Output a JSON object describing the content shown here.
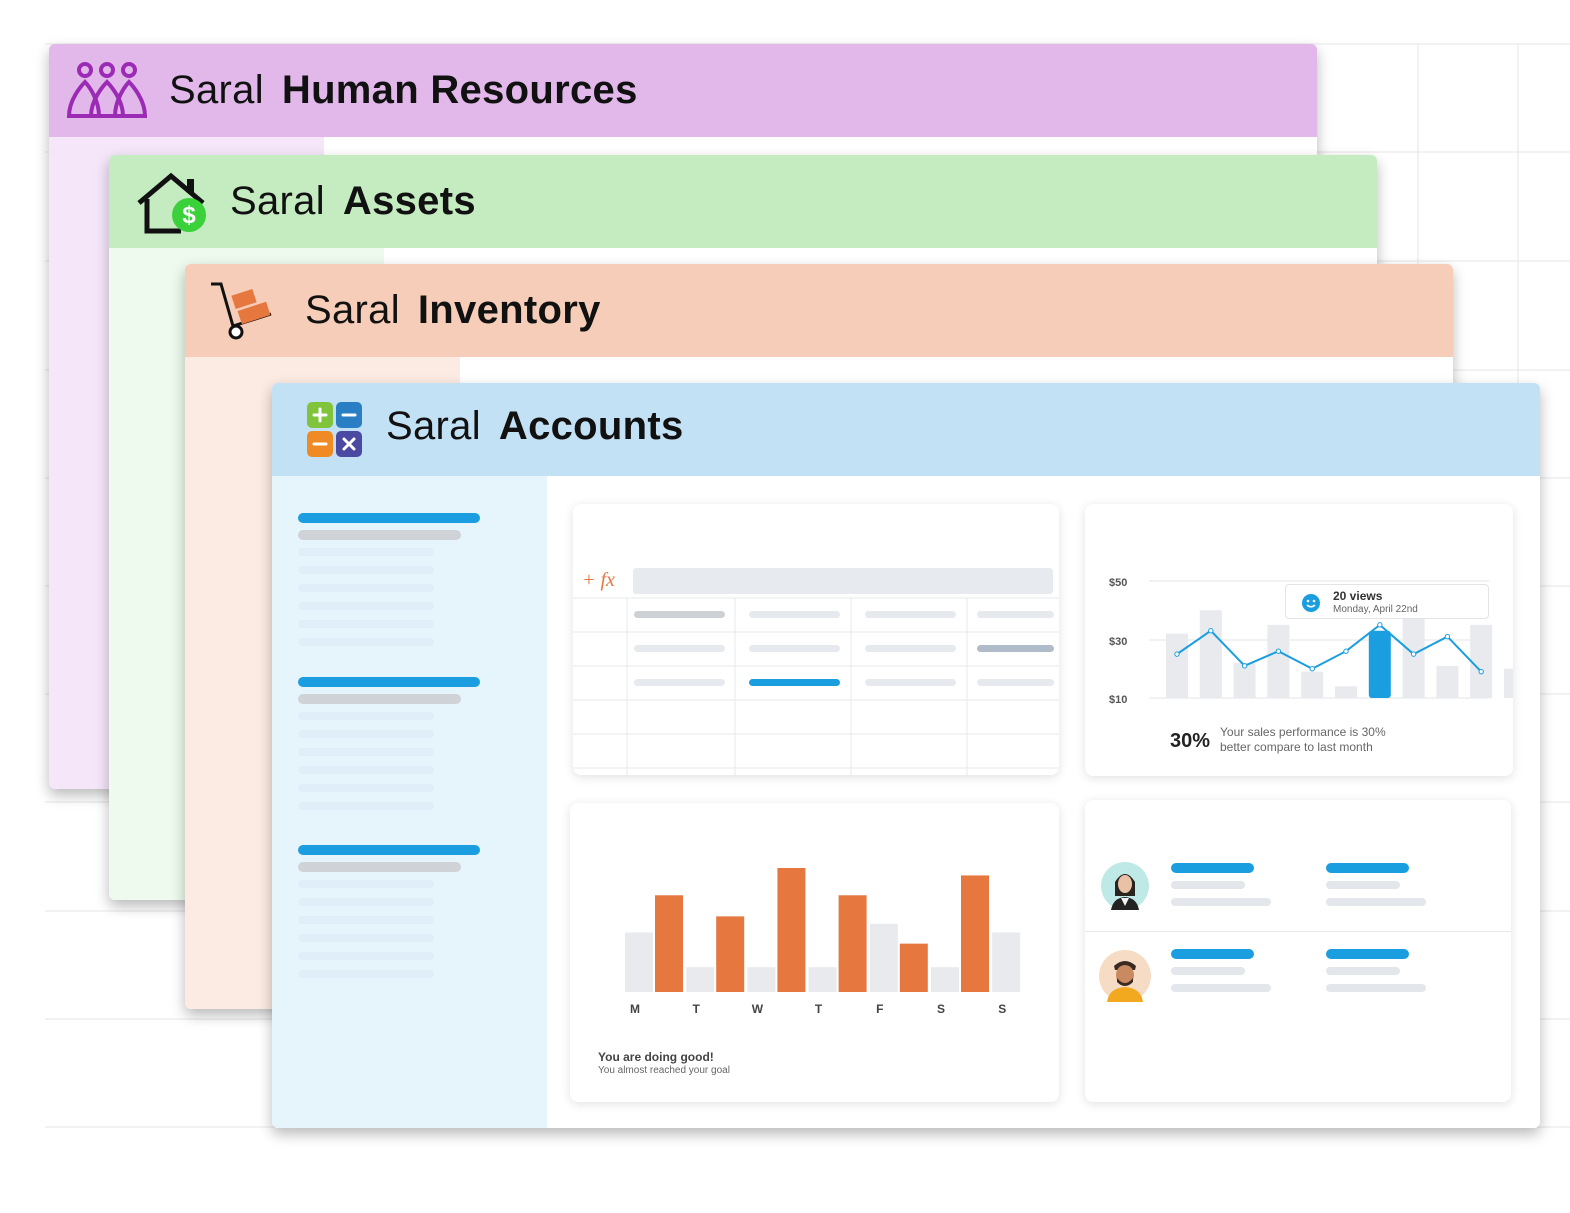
{
  "windows": {
    "hr": {
      "brand": "Saral",
      "app": "Human Resources",
      "icon": "people-icon",
      "header_color": "#e2b8ea",
      "body_color": "#f5e6fa"
    },
    "assets": {
      "brand": "Saral",
      "app": "Assets",
      "icon": "house-dollar-icon",
      "header_color": "#c5ebc1",
      "body_color": "#eefaed"
    },
    "inventory": {
      "brand": "Saral",
      "app": "Inventory",
      "icon": "hand-truck-icon",
      "header_color": "#f6cdb8",
      "body_color": "#fbebe3"
    },
    "accounts": {
      "brand": "Saral",
      "app": "Accounts",
      "icon": "calculator-icon",
      "header_color": "#c2e1f4",
      "body_color": "#e6f4fc"
    }
  },
  "spreadsheet": {
    "formula_icon": "+ fx"
  },
  "views_chart": {
    "yticks": [
      "$50",
      "$30",
      "$10"
    ],
    "tooltip_title": "20 views",
    "tooltip_sub": "Monday, April 22nd",
    "tooltip_icon": "smiley-icon",
    "percent": "30%",
    "desc_line1": "Your sales performance is 30%",
    "desc_line2": "better compare to last month"
  },
  "weekly_card": {
    "headline": "You are doing good!",
    "subline": "You almost reached your goal"
  },
  "chart_data": [
    {
      "type": "bar",
      "ylim": [
        0,
        60
      ],
      "ytick_labels": [
        "$50",
        "$30",
        "$10"
      ],
      "series": [
        {
          "values": [
            32,
            40,
            22,
            35,
            19,
            14,
            33,
            40,
            21,
            35,
            20
          ]
        }
      ],
      "highlight_index": 6
    },
    {
      "type": "line",
      "ylim": [
        0,
        60
      ],
      "series": [
        {
          "values": [
            25,
            33,
            21,
            26,
            20,
            26,
            35,
            25,
            31,
            19
          ]
        }
      ]
    },
    {
      "type": "bar",
      "categories": [
        "M",
        "T",
        "W",
        "T",
        "F",
        "S",
        "S"
      ],
      "colors": {
        "primary": "#e5773f",
        "secondary": "#e8eaee"
      },
      "series": [
        {
          "values": [
            48,
            20,
            20,
            20,
            55,
            20,
            48
          ]
        },
        {
          "values": [
            78,
            61,
            100,
            78,
            39,
            94,
            0
          ]
        }
      ]
    }
  ],
  "colors": {
    "accent_blue": "#1a9ee0",
    "orange": "#e5773f"
  }
}
